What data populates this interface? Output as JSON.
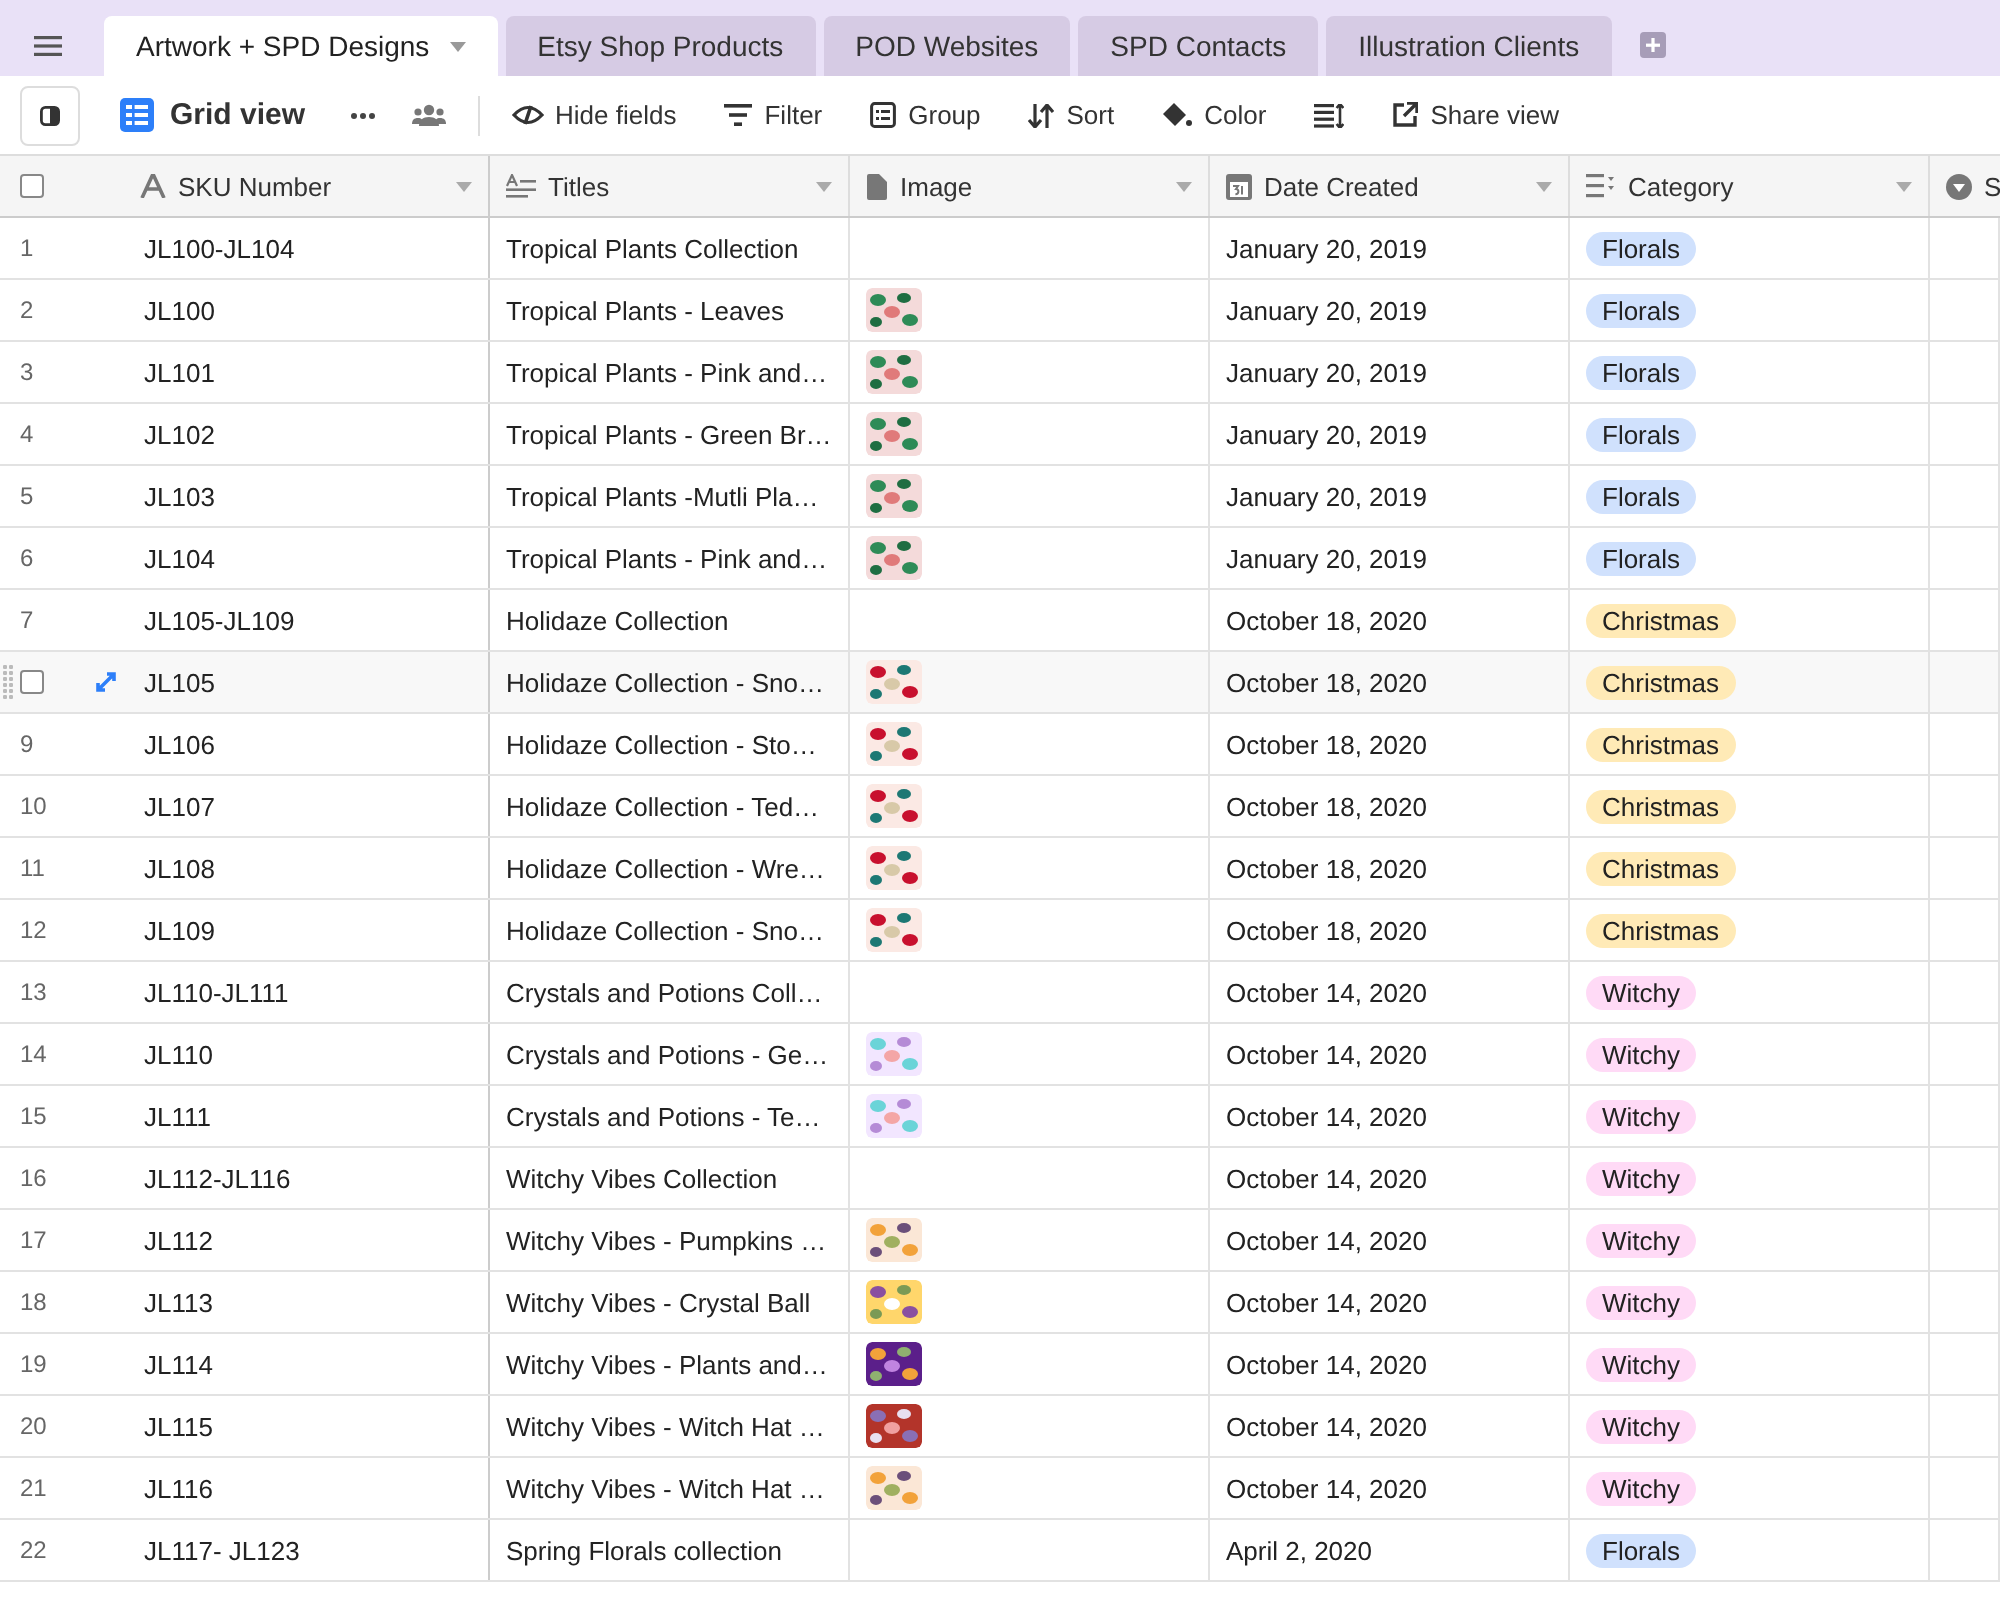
{
  "tabs": [
    {
      "label": "Artwork + SPD Designs",
      "selected": true
    },
    {
      "label": "Etsy Shop Products",
      "selected": false
    },
    {
      "label": "POD Websites",
      "selected": false
    },
    {
      "label": "SPD Contacts",
      "selected": false
    },
    {
      "label": "Illustration Clients",
      "selected": false
    }
  ],
  "toolbar": {
    "view": "Grid view",
    "buttons": [
      {
        "kind": "hide",
        "label": "Hide fields"
      },
      {
        "kind": "filter",
        "label": "Filter"
      },
      {
        "kind": "group",
        "label": "Group"
      },
      {
        "kind": "sort",
        "label": "Sort"
      },
      {
        "kind": "color",
        "label": "Color"
      },
      {
        "kind": "height"
      },
      {
        "kind": "share",
        "label": "Share view"
      }
    ]
  },
  "select_all": {
    "checked": false
  },
  "columns": [
    {
      "kind": "text",
      "label": "SKU Number"
    },
    {
      "kind": "longtext",
      "label": "Titles"
    },
    {
      "kind": "attachment",
      "label": "Image"
    },
    {
      "kind": "date",
      "label": "Date Created"
    },
    {
      "kind": "select",
      "label": "Category"
    },
    {
      "kind": "status",
      "label": "S"
    }
  ],
  "rows": [
    {
      "number": "1",
      "hovered": false,
      "sku": "JL100-JL104",
      "title": "Tropical Plants Collection",
      "date": "January 20, 2019",
      "category": {
        "label": "Florals",
        "color": "#d0e1fd"
      }
    },
    {
      "number": "2",
      "hovered": false,
      "sku": "JL100",
      "title": "Tropical Plants - Leaves",
      "date": "January 20, 2019",
      "category": {
        "label": "Florals",
        "color": "#d0e1fd"
      }
    },
    {
      "number": "3",
      "hovered": false,
      "sku": "JL101",
      "title": "Tropical Plants - Pink and…",
      "date": "January 20, 2019",
      "category": {
        "label": "Florals",
        "color": "#d0e1fd"
      }
    },
    {
      "number": "4",
      "hovered": false,
      "sku": "JL102",
      "title": "Tropical Plants - Green Br…",
      "date": "January 20, 2019",
      "category": {
        "label": "Florals",
        "color": "#d0e1fd"
      }
    },
    {
      "number": "5",
      "hovered": false,
      "sku": "JL103",
      "title": "Tropical Plants -Mutli Pla…",
      "date": "January 20, 2019",
      "category": {
        "label": "Florals",
        "color": "#d0e1fd"
      }
    },
    {
      "number": "6",
      "hovered": false,
      "sku": "JL104",
      "title": "Tropical Plants - Pink and…",
      "date": "January 20, 2019",
      "category": {
        "label": "Florals",
        "color": "#d0e1fd"
      }
    },
    {
      "number": "7",
      "hovered": false,
      "sku": "JL105-JL109",
      "title": "Holidaze Collection",
      "date": "October 18, 2020",
      "category": {
        "label": "Christmas",
        "color": "#ffeab6"
      }
    },
    {
      "hovered": true,
      "checked": false,
      "sku": "JL105",
      "title": "Holidaze Collection - Sno…",
      "date": "October 18, 2020",
      "category": {
        "label": "Christmas",
        "color": "#ffeab6"
      }
    },
    {
      "number": "9",
      "hovered": false,
      "sku": "JL106",
      "title": "Holidaze Collection - Sto…",
      "date": "October 18, 2020",
      "category": {
        "label": "Christmas",
        "color": "#ffeab6"
      }
    },
    {
      "number": "10",
      "hovered": false,
      "sku": "JL107",
      "title": "Holidaze Collection - Ted…",
      "date": "October 18, 2020",
      "category": {
        "label": "Christmas",
        "color": "#ffeab6"
      }
    },
    {
      "number": "11",
      "hovered": false,
      "sku": "JL108",
      "title": "Holidaze Collection - Wre…",
      "date": "October 18, 2020",
      "category": {
        "label": "Christmas",
        "color": "#ffeab6"
      }
    },
    {
      "number": "12",
      "hovered": false,
      "sku": "JL109",
      "title": "Holidaze Collection - Sno…",
      "date": "October 18, 2020",
      "category": {
        "label": "Christmas",
        "color": "#ffeab6"
      }
    },
    {
      "number": "13",
      "hovered": false,
      "sku": "JL110-JL111",
      "title": "Crystals and Potions Coll…",
      "date": "October 14, 2020",
      "category": {
        "label": "Witchy",
        "color": "#ffdaf6"
      }
    },
    {
      "number": "14",
      "hovered": false,
      "sku": "JL110",
      "title": "Crystals and Potions - Ge…",
      "date": "October 14, 2020",
      "category": {
        "label": "Witchy",
        "color": "#ffdaf6"
      }
    },
    {
      "number": "15",
      "hovered": false,
      "sku": "JL111",
      "title": "Crystals and Potions - Te…",
      "date": "October 14, 2020",
      "category": {
        "label": "Witchy",
        "color": "#ffdaf6"
      }
    },
    {
      "number": "16",
      "hovered": false,
      "sku": "JL112-JL116",
      "title": "Witchy Vibes Collection",
      "date": "October 14, 2020",
      "category": {
        "label": "Witchy",
        "color": "#ffdaf6"
      }
    },
    {
      "number": "17",
      "hovered": false,
      "sku": "JL112",
      "title": "Witchy Vibes - Pumpkins …",
      "date": "October 14, 2020",
      "category": {
        "label": "Witchy",
        "color": "#ffdaf6"
      }
    },
    {
      "number": "18",
      "hovered": false,
      "sku": "JL113",
      "title": "Witchy Vibes - Crystal Ball",
      "date": "October 14, 2020",
      "category": {
        "label": "Witchy",
        "color": "#ffdaf6"
      }
    },
    {
      "number": "19",
      "hovered": false,
      "sku": "JL114",
      "title": "Witchy Vibes - Plants and…",
      "date": "October 14, 2020",
      "category": {
        "label": "Witchy",
        "color": "#ffdaf6"
      }
    },
    {
      "number": "20",
      "hovered": false,
      "sku": "JL115",
      "title": "Witchy Vibes - Witch Hat …",
      "date": "October 14, 2020",
      "category": {
        "label": "Witchy",
        "color": "#ffdaf6"
      }
    },
    {
      "number": "21",
      "hovered": false,
      "sku": "JL116",
      "title": "Witchy Vibes - Witch Hat …",
      "date": "October 14, 2020",
      "category": {
        "label": "Witchy",
        "color": "#ffdaf6"
      }
    },
    {
      "number": "22",
      "hovered": false,
      "sku": "JL117- JL123",
      "title": "Spring Florals collection",
      "date": "April 2, 2020",
      "category": {
        "label": "Florals",
        "color": "#d0e1fd"
      }
    }
  ]
}
